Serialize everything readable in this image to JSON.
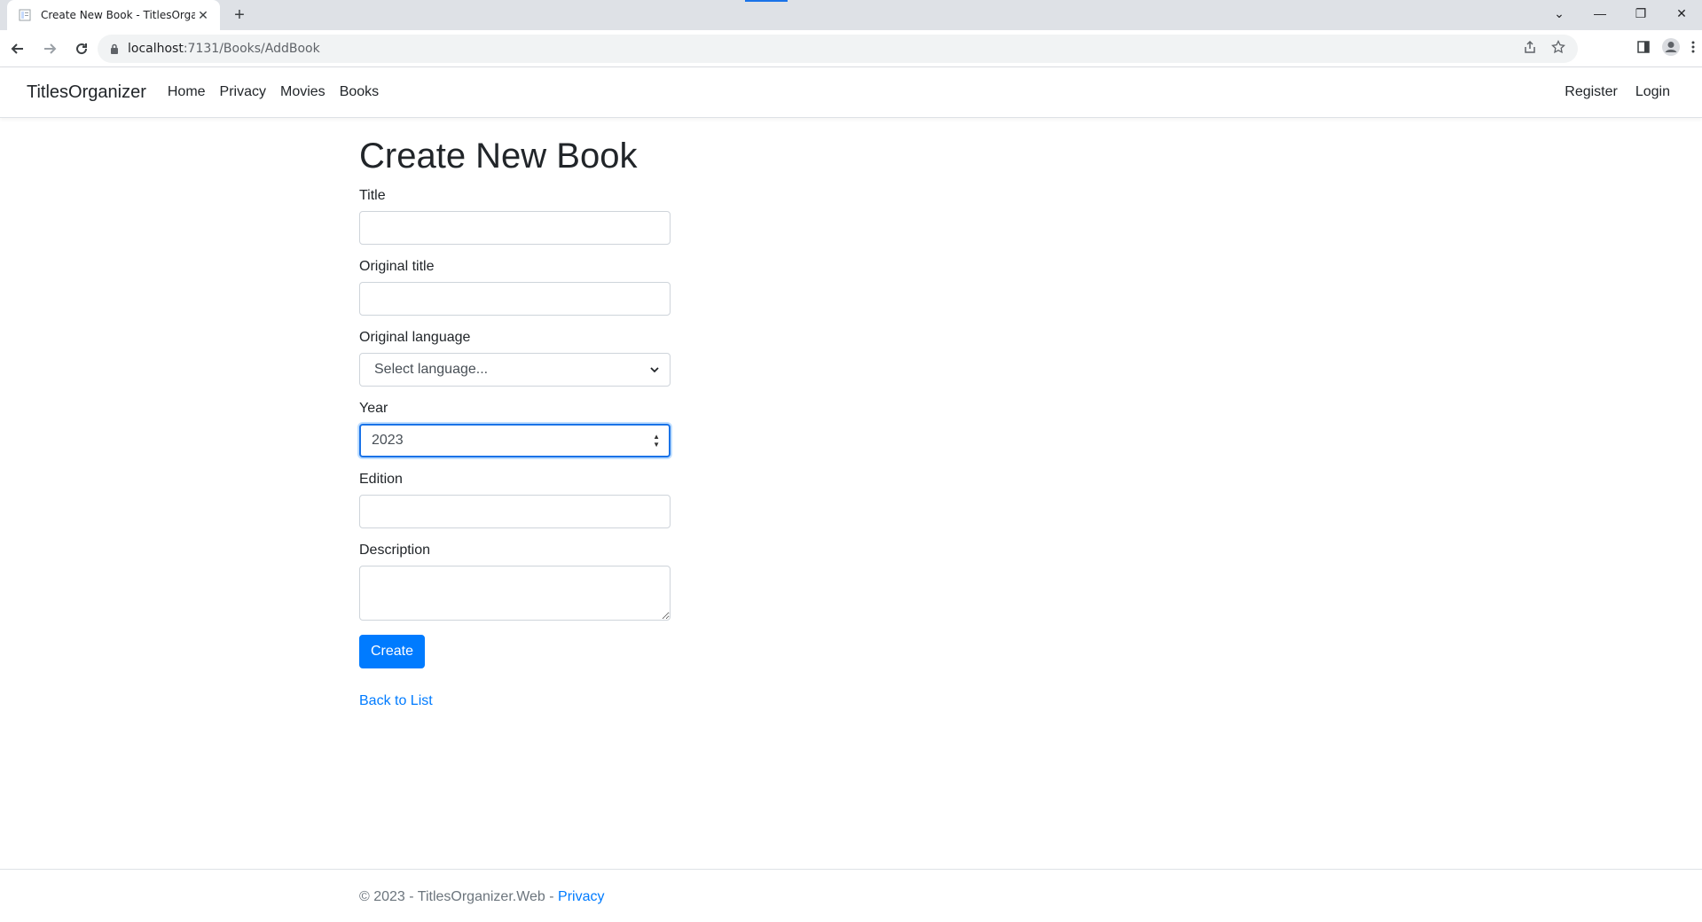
{
  "browser": {
    "tab_title": "Create New Book - TitlesOrganizer",
    "url_host": "localhost",
    "url_path": ":7131/Books/AddBook",
    "new_tab_icon": "plus-icon"
  },
  "navbar": {
    "brand": "TitlesOrganizer",
    "links": [
      "Home",
      "Privacy",
      "Movies",
      "Books"
    ],
    "right_links": [
      "Register",
      "Login"
    ]
  },
  "form": {
    "heading": "Create New Book",
    "title_label": "Title",
    "title_value": "",
    "original_title_label": "Original title",
    "original_title_value": "",
    "language_label": "Original language",
    "language_selected": "Select language...",
    "year_label": "Year",
    "year_value": "2023",
    "edition_label": "Edition",
    "edition_value": "",
    "description_label": "Description",
    "description_value": "",
    "create_button": "Create",
    "back_link": "Back to List"
  },
  "footer": {
    "text": "© 2023 - TitlesOrganizer.Web - ",
    "privacy_link": "Privacy"
  },
  "colors": {
    "primary": "#007bff",
    "focus_border": "#1a73e8"
  }
}
